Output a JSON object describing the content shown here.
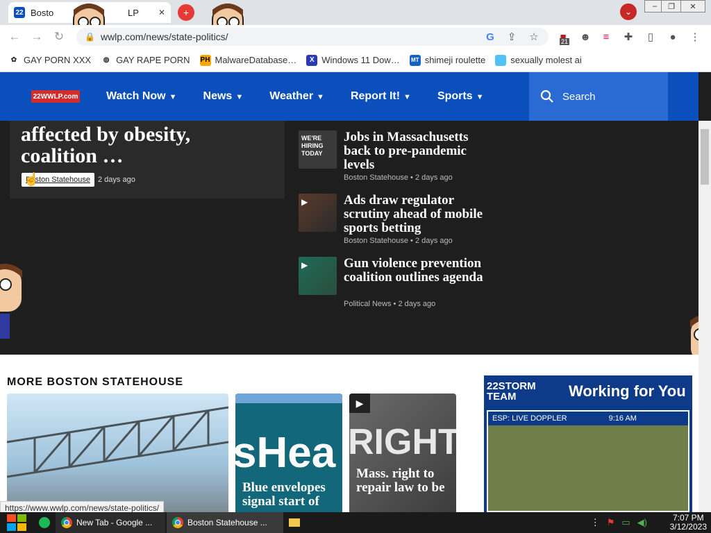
{
  "browser": {
    "tabs": [
      {
        "label": "Bosto"
      },
      {
        "label": "LP"
      }
    ],
    "url": "wwlp.com/news/state-politics/",
    "profile_badge": "21",
    "window_controls": {
      "minimize": "–",
      "restore": "❐",
      "close": "✕"
    }
  },
  "bookmarks": [
    {
      "label": "GAY PORN XXX",
      "icon": "paw-icon"
    },
    {
      "label": "GAY RAPE PORN",
      "icon": "globe-icon"
    },
    {
      "label": "MalwareDatabase…",
      "icon": "ph-icon",
      "icon_text": "PH"
    },
    {
      "label": "Windows 11 Dow…",
      "icon": "x-icon",
      "icon_text": "X"
    },
    {
      "label": "shimeji roulette",
      "icon": "mt-icon",
      "icon_text": "MT"
    },
    {
      "label": "sexually molest ai",
      "icon": "app-icon"
    }
  ],
  "site": {
    "logo_text": "22WWLP.com",
    "nav": [
      {
        "label": "Watch Now"
      },
      {
        "label": "News"
      },
      {
        "label": "Weather"
      },
      {
        "label": "Report It!"
      },
      {
        "label": "Sports"
      }
    ],
    "search_placeholder": "Search",
    "accent": "#0b4fbd"
  },
  "hero": {
    "title_line1": "affected by obesity,",
    "title_line2": "coalition …",
    "tag": "Boston Statehouse",
    "age": "2 days ago"
  },
  "stories": [
    {
      "title": "Jobs in Massachusetts back to pre-pandemic levels",
      "source": "Boston Statehouse",
      "age": "2 days ago",
      "video": false,
      "thumb_text": "WE'RE HIRING TODAY"
    },
    {
      "title": "Ads draw regulator scrutiny ahead of mobile sports betting",
      "source": "Boston Statehouse",
      "age": "2 days ago",
      "video": true
    },
    {
      "title": "Gun violence prevention coalition outlines agenda",
      "source": "Political News",
      "age": "2 days ago",
      "video": true
    }
  ],
  "more": {
    "heading": "MORE BOSTON STATEHOUSE",
    "cards": [
      {
        "title": ""
      },
      {
        "title": "Blue envelopes signal start of",
        "thumb_text": "sHea"
      },
      {
        "title": "Mass. right to repair law to be",
        "thumb_text": "RIGHT"
      }
    ]
  },
  "ad": {
    "brand": "22STORM TEAM",
    "tagline": "Working for You",
    "sub": "ESP: LIVE DOPPLER",
    "time": "9:16 AM"
  },
  "status_url": "https://www.wwlp.com/news/state-politics/",
  "taskbar": {
    "items": [
      {
        "label": "New Tab - Google ..."
      },
      {
        "label": "Boston Statehouse ..."
      }
    ],
    "time": "7:07 PM",
    "date": "3/12/2023"
  }
}
